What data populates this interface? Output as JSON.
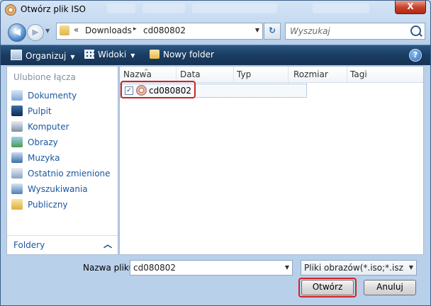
{
  "window": {
    "title": "Otwórz plik ISO",
    "close_label": "X"
  },
  "nav": {
    "address_overflow": "«",
    "path": [
      "Downloads",
      "cd080802"
    ],
    "path_separator": "▸",
    "search_placeholder": "Wyszukaj"
  },
  "toolbar": {
    "organize_label": "Organizuj",
    "views_label": "Widoki",
    "new_folder_label": "Nowy folder",
    "help_label": "?"
  },
  "sidebar": {
    "heading": "Ulubione łącza",
    "items": [
      {
        "label": "Dokumenty",
        "icon": "documents-icon"
      },
      {
        "label": "Pulpit",
        "icon": "desktop-icon"
      },
      {
        "label": "Komputer",
        "icon": "computer-icon"
      },
      {
        "label": "Obrazy",
        "icon": "pictures-icon"
      },
      {
        "label": "Muzyka",
        "icon": "music-icon"
      },
      {
        "label": "Ostatnio zmienione",
        "icon": "recent-icon"
      },
      {
        "label": "Wyszukiwania",
        "icon": "searches-icon"
      },
      {
        "label": "Publiczny",
        "icon": "public-folder-icon"
      }
    ],
    "folders_label": "Foldery"
  },
  "file_list": {
    "columns": [
      "Nazwa",
      "Data mody...",
      "Typ",
      "Rozmiar",
      "Tagi"
    ],
    "rows": [
      {
        "name": "cd080802",
        "checked": true
      }
    ]
  },
  "footer": {
    "filename_label": "Nazwa pliku:",
    "filename_value": "cd080802",
    "filetype_value": "Pliki obrazów(*.iso;*.isz;*.mds;",
    "open_label": "Otwórz",
    "cancel_label": "Anuluj"
  },
  "colors": {
    "highlight": "#d62121",
    "link": "#1a57a0",
    "toolbar": "#1a3c62"
  }
}
